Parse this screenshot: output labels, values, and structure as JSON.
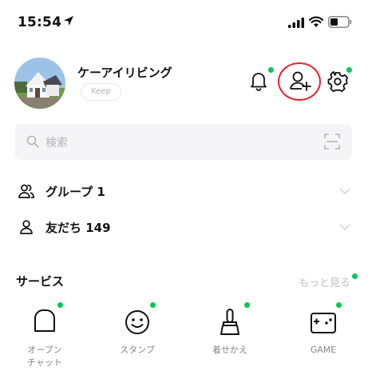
{
  "status_bar": {
    "time": "15:54"
  },
  "profile": {
    "name": "ケーアイリビング",
    "keep_label": "Keep"
  },
  "search": {
    "placeholder": "検索"
  },
  "rows": [
    {
      "label": "グループ 1"
    },
    {
      "label": "友だち 149"
    }
  ],
  "services": {
    "title": "サービス",
    "see_more": "もっと見る",
    "items": [
      {
        "label": "オープン\nチャット",
        "icon": "open-chat-icon"
      },
      {
        "label": "スタンプ",
        "icon": "sticker-icon"
      },
      {
        "label": "着せかえ",
        "icon": "theme-icon"
      },
      {
        "label": "GAME",
        "icon": "game-icon"
      }
    ]
  },
  "colors": {
    "badge_green": "#06c755",
    "highlight_red": "#e8202a"
  }
}
